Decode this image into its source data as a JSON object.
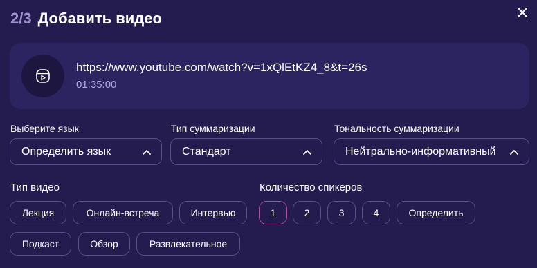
{
  "header": {
    "step": "2/3",
    "title": "Добавить видео"
  },
  "video": {
    "url": "https://www.youtube.com/watch?v=1xQlEtKZ4_8&t=26s",
    "duration": "01:35:00",
    "icon": "video-play-icon"
  },
  "fields": {
    "language": {
      "label": "Выберите язык",
      "value": "Определить язык"
    },
    "summary_type": {
      "label": "Тип суммаризации",
      "value": "Стандарт"
    },
    "tone": {
      "label": "Тональность суммаризации",
      "value": "Нейтрально-информативный"
    }
  },
  "video_type": {
    "label": "Тип видео",
    "options": [
      "Лекция",
      "Онлайн-встреча",
      "Интервью",
      "Подкаст",
      "Обзор",
      "Развлекательное"
    ]
  },
  "speakers": {
    "label": "Количество спикеров",
    "options": [
      "1",
      "2",
      "3",
      "4",
      "Определить"
    ],
    "selected": "1"
  },
  "colors": {
    "background": "#241b4f",
    "card": "#2c2461",
    "border": "#59508a",
    "accent": "#b0509e",
    "muted": "#b3a7e3"
  }
}
